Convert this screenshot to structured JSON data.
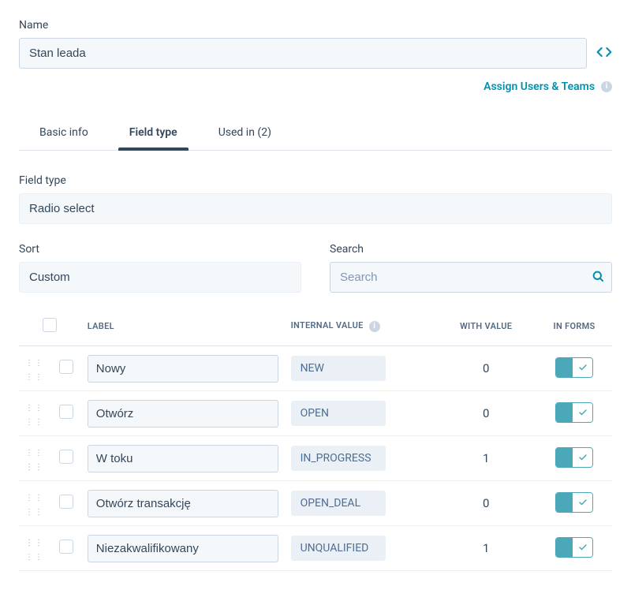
{
  "name_label": "Name",
  "name_value": "Stan leada",
  "assign_link": "Assign Users & Teams",
  "tabs": [
    {
      "label": "Basic info"
    },
    {
      "label": "Field type"
    },
    {
      "label": "Used in (2)"
    }
  ],
  "field_type_label": "Field type",
  "field_type_value": "Radio select",
  "sort_label": "Sort",
  "sort_value": "Custom",
  "search_label": "Search",
  "search_placeholder": "Search",
  "table_headers": {
    "label": "LABEL",
    "internal": "INTERNAL VALUE",
    "with_value": "WITH VALUE",
    "in_forms": "IN FORMS"
  },
  "rows": [
    {
      "label": "Nowy",
      "internal": "NEW",
      "with_value": "0",
      "in_forms": true
    },
    {
      "label": "Otwórz",
      "internal": "OPEN",
      "with_value": "0",
      "in_forms": true
    },
    {
      "label": "W toku",
      "internal": "IN_PROGRESS",
      "with_value": "1",
      "in_forms": true
    },
    {
      "label": "Otwórz transakcję",
      "internal": "OPEN_DEAL",
      "with_value": "0",
      "in_forms": true
    },
    {
      "label": "Niezakwalifikowany",
      "internal": "UNQUALIFIED",
      "with_value": "1",
      "in_forms": true
    }
  ]
}
